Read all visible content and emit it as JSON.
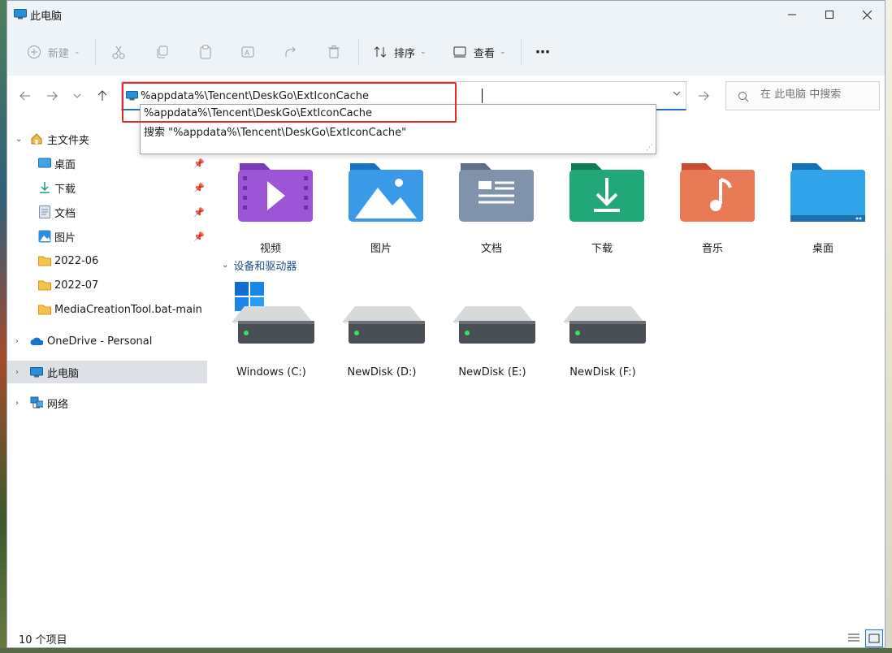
{
  "window": {
    "title": "此电脑",
    "controls": {
      "minimize": "minimize",
      "maximize": "maximize",
      "close": "close"
    }
  },
  "commandbar": {
    "new_label": "新建",
    "sort_label": "排序",
    "view_label": "查看",
    "more": "⋯"
  },
  "address": {
    "value": "%appdata%\\Tencent\\DeskGo\\ExtIconCache",
    "suggestions": [
      "%appdata%\\Tencent\\DeskGo\\ExtIconCache",
      "搜索 \"%appdata%\\Tencent\\DeskGo\\ExtIconCache\""
    ]
  },
  "search": {
    "placeholder": "在 此电脑 中搜索"
  },
  "sidebar": {
    "home": "主文件夹",
    "items": [
      {
        "label": "桌面",
        "pinned": true,
        "icon": "desktop-icon"
      },
      {
        "label": "下载",
        "pinned": true,
        "icon": "download-icon"
      },
      {
        "label": "文档",
        "pinned": true,
        "icon": "document-icon"
      },
      {
        "label": "图片",
        "pinned": true,
        "icon": "picture-icon"
      },
      {
        "label": "2022-06",
        "pinned": false,
        "icon": "folder-icon"
      },
      {
        "label": "2022-07",
        "pinned": false,
        "icon": "folder-icon"
      },
      {
        "label": "MediaCreationTool.bat-main",
        "pinned": false,
        "icon": "folder-icon"
      }
    ],
    "onedrive": "OneDrive - Personal",
    "thispc": "此电脑",
    "network": "网络"
  },
  "folders": [
    {
      "label": "视频",
      "icon": "video-folder-icon",
      "color": "#8e44c7"
    },
    {
      "label": "图片",
      "icon": "pictures-folder-icon",
      "color": "#2f8ee0"
    },
    {
      "label": "文档",
      "icon": "documents-folder-icon",
      "color": "#7a8fa8"
    },
    {
      "label": "下载",
      "icon": "downloads-folder-icon",
      "color": "#1f9e6e"
    },
    {
      "label": "音乐",
      "icon": "music-folder-icon",
      "color": "#e26a4e"
    },
    {
      "label": "桌面",
      "icon": "desktop-folder-icon",
      "color": "#2d9be6"
    }
  ],
  "devices_section": "设备和驱动器",
  "drives": [
    {
      "label": "Windows (C:)",
      "system": true
    },
    {
      "label": "NewDisk (D:)",
      "system": false
    },
    {
      "label": "NewDisk (E:)",
      "system": false
    },
    {
      "label": "NewDisk (F:)",
      "system": false
    }
  ],
  "status": {
    "count": "10 个项目"
  },
  "colors": {
    "accent": "#2a6fbf",
    "highlight": "#e62828",
    "selected_bg": "#dde1e6"
  }
}
